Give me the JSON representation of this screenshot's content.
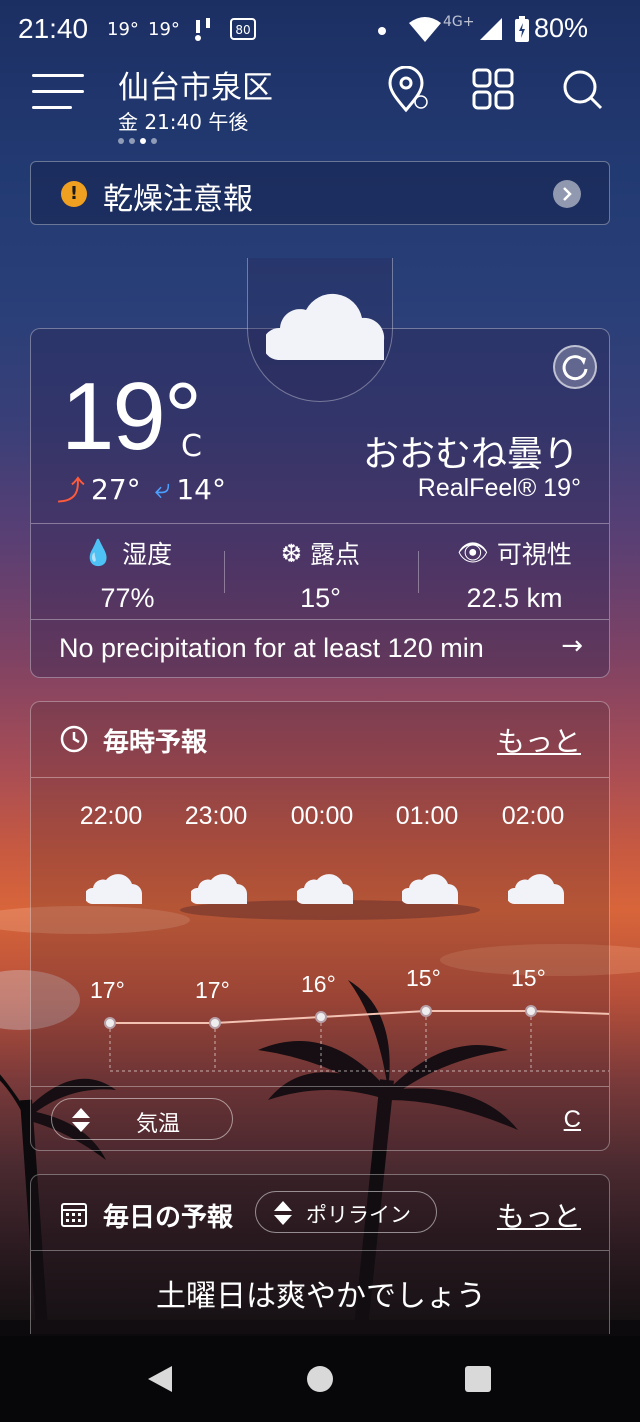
{
  "status_bar": {
    "time": "21:40",
    "temp_a": "19°",
    "temp_b": "19°",
    "network": "4G+",
    "battery": "80%"
  },
  "header": {
    "location": "仙台市泉区",
    "datetime": "金 21:40 午後",
    "icons": [
      "menu-icon",
      "location-pin-icon",
      "grid-icon",
      "search-icon"
    ]
  },
  "alert": {
    "text": "乾燥注意報",
    "color": "#f0a020"
  },
  "current": {
    "temp": "19°",
    "unit": "C",
    "high": "27°",
    "low": "14°",
    "condition": "おおむね曇り",
    "realfeel": "RealFeel® 19°",
    "metrics": [
      {
        "label": "湿度",
        "value": "77%",
        "icon": "droplet-icon"
      },
      {
        "label": "露点",
        "value": "15°",
        "icon": "dew-point-icon"
      },
      {
        "label": "可視性",
        "value": "22.5 km",
        "icon": "eye-icon"
      }
    ],
    "precip": "No precipitation for at least 120 min"
  },
  "hourly": {
    "title": "毎時予報",
    "more": "もっと",
    "hours": [
      {
        "time": "22:00",
        "temp": "17°",
        "value": 17
      },
      {
        "time": "23:00",
        "temp": "17°",
        "value": 17
      },
      {
        "time": "00:00",
        "temp": "16°",
        "value": 16
      },
      {
        "time": "01:00",
        "temp": "15°",
        "value": 15
      },
      {
        "time": "02:00",
        "temp": "15°",
        "value": 15
      }
    ],
    "selector_label": "気温",
    "unit_toggle": "C"
  },
  "daily": {
    "title": "毎日の予報",
    "selector_label": "ポリライン",
    "more": "もっと",
    "message": "土曜日は爽やかでしょう"
  }
}
